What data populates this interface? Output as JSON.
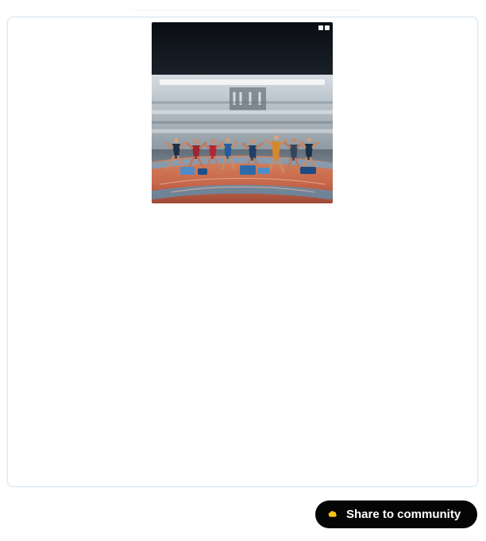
{
  "result": {
    "image_description": "Runners sprinting on a stadium track"
  },
  "actions": {
    "share_label": "Share to community"
  },
  "colors": {
    "panel_border": "#d7e6ef",
    "button_background": "#050505",
    "button_text": "#ffffff",
    "share_icon": "#f2c21b"
  },
  "icons": {
    "share": "community-share-icon"
  }
}
